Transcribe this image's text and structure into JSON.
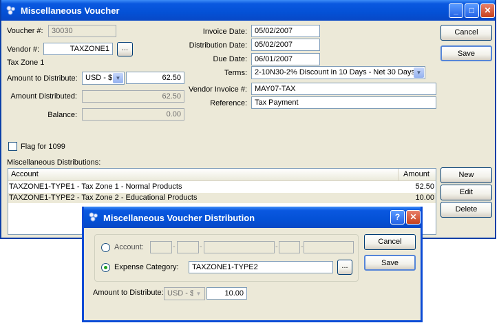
{
  "main_window": {
    "title": "Miscellaneous Voucher",
    "controls": {
      "minimize": "_",
      "maximize": "□",
      "close": "✕"
    },
    "voucher_label": "Voucher #:",
    "voucher_value": "30030",
    "vendor_label": "Vendor #:",
    "vendor_value": "TAXZONE1",
    "vendor_lookup": "...",
    "vendor_name": "Tax Zone 1",
    "amount_to_distribute_label": "Amount to Distribute:",
    "currency": "USD - $",
    "amount_to_distribute": "62.50",
    "amount_distributed_label": "Amount Distributed:",
    "amount_distributed": "62.50",
    "balance_label": "Balance:",
    "balance": "0.00",
    "invoice_date_label": "Invoice Date:",
    "invoice_date": "05/02/2007",
    "distribution_date_label": "Distribution Date:",
    "distribution_date": "05/02/2007",
    "due_date_label": "Due Date:",
    "due_date": "06/01/2007",
    "terms_label": "Terms:",
    "terms": "2-10N30-2% Discount in 10 Days - Net 30 Days",
    "vendor_invoice_label": "Vendor Invoice #:",
    "vendor_invoice": "MAY07-TAX",
    "reference_label": "Reference:",
    "reference": "Tax Payment",
    "flag_1099_label": "Flag for 1099",
    "flag_1099_checked": false,
    "cancel_button": "Cancel",
    "save_button": "Save",
    "distributions_label": "Miscellaneous Distributions:",
    "columns": {
      "account": "Account",
      "amount": "Amount"
    },
    "rows": [
      {
        "account": "TAXZONE1-TYPE1 - Tax Zone 1 - Normal Products",
        "amount": "52.50"
      },
      {
        "account": "TAXZONE1-TYPE2 - Tax Zone 2 - Educational Products",
        "amount": "10.00"
      }
    ],
    "new_button": "New",
    "edit_button": "Edit",
    "delete_button": "Delete"
  },
  "dialog": {
    "title": "Miscellaneous Voucher Distribution",
    "help": "?",
    "close": "✕",
    "account_label": "Account:",
    "account_selected": false,
    "expense_category_label": "Expense Category:",
    "expense_category_selected": true,
    "expense_category": "TAXZONE1-TYPE2",
    "lookup": "...",
    "amount_label": "Amount to Distribute:",
    "currency": "USD - $",
    "amount": "10.00",
    "cancel_button": "Cancel",
    "save_button": "Save"
  },
  "colors": {
    "titlebar": "#0451d6",
    "face": "#ece9d8",
    "selected_row": "#ffffff"
  },
  "icons": {
    "app": "app-logo-icon",
    "dropdown": "chevron-down-icon"
  }
}
